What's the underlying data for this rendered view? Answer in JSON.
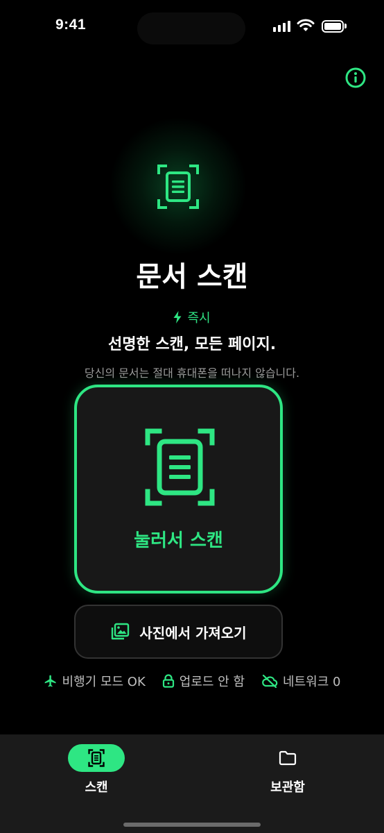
{
  "status_bar": {
    "time": "9:41",
    "signal_icon": "cellular-signal-icon",
    "wifi_icon": "wifi-icon",
    "battery_icon": "battery-icon"
  },
  "header": {
    "info_icon": "info-icon"
  },
  "hero": {
    "icon": "document-scan-icon",
    "title": "문서 스캔",
    "badge_icon": "lightning-icon",
    "badge_text": "즉시",
    "subtitle": "선명한 스캔, 모든 페이지.",
    "tagline": "당신의 문서는 절대 휴대폰을 떠나지 않습니다."
  },
  "scan_button": {
    "icon": "document-scan-icon",
    "label": "눌러서 스캔"
  },
  "import_button": {
    "icon": "photo-library-icon",
    "label": "사진에서 가져오기"
  },
  "features": [
    {
      "icon": "airplane-icon",
      "label": "비행기 모드 OK"
    },
    {
      "icon": "lock-icon",
      "label": "업로드 안 함"
    },
    {
      "icon": "cloud-off-icon",
      "label": "네트워크 0"
    }
  ],
  "tab_bar": {
    "tabs": [
      {
        "icon": "document-scan-icon",
        "label": "스캔",
        "active": true
      },
      {
        "icon": "folder-icon",
        "label": "보관함",
        "active": false
      }
    ]
  },
  "colors": {
    "accent": "#2EE683",
    "background": "#000000",
    "card_background": "#181818",
    "tab_bar_background": "#1B1B1B",
    "muted_text": "#9A9A9A"
  }
}
